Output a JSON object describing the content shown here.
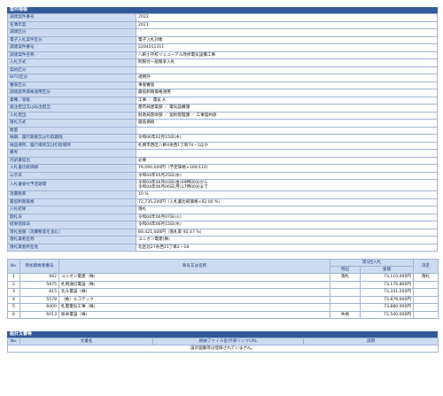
{
  "section_title": "案件情報",
  "info_rows": [
    {
      "key": "調達案件番号",
      "value": "2022"
    },
    {
      "key": "名簿年度",
      "value": "2021"
    },
    {
      "key": "調達区分",
      "value": ""
    },
    {
      "key": "電子入札案件区分",
      "value": "電子入札対象"
    },
    {
      "key": "調達案件番号",
      "value": "2204011311"
    },
    {
      "key": "調達案件名称",
      "value": "八軒小学校リニューアル改修電気設備工事"
    },
    {
      "key": "入札方式",
      "value": "制限付一般競争入札"
    },
    {
      "key": "契約区分",
      "value": ""
    },
    {
      "key": "WTO区分",
      "value": "適用外"
    },
    {
      "key": "審査区分",
      "value": "事後審査"
    },
    {
      "key": "調達基準価格適用区分",
      "value": "最低制限価格適用"
    },
    {
      "key": "業種／等級",
      "value": "工事 ／ 電気 A"
    },
    {
      "key": "発注担当又は払出担当",
      "value": "都市局建築部 ／ 電気設備課"
    },
    {
      "key": "入札担当",
      "value": "財政局管財部 ／ 契約管理課 ／ 工事契約係"
    },
    {
      "key": "落札方式",
      "value": "最低価格"
    },
    {
      "key": "数量",
      "value": ""
    },
    {
      "key": "納期、履行期限又は引取期限",
      "value": "令和06年02月15日(木)"
    },
    {
      "key": "納品場所、履行場所又は引取場所",
      "value": "札幌市西区八軒4条西1丁目74－2ほか"
    },
    {
      "key": "備考",
      "value": ""
    },
    {
      "key": "内訳書提出",
      "value": "必要"
    },
    {
      "key": "入札書比較価格",
      "value": "79,060,000円（予定価格×100/110）"
    },
    {
      "key": "公示日",
      "value": "令和04年05月25日(水)"
    },
    {
      "key": "入札書受付予定期間",
      "value": "令和04年06月03日(金)09時00分から\n令和04年06月06日(月)17時00分まで"
    },
    {
      "key": "消費税率",
      "value": "10 %"
    },
    {
      "key": "最低制限価格",
      "value": "72,735,200円（入札書比較価格×92.00 %）"
    },
    {
      "key": "入札結果",
      "value": "落札"
    },
    {
      "key": "開札日",
      "value": "令和04年06月07日(火)"
    },
    {
      "key": "結果登録日",
      "value": "令和04年06月15日(水)"
    },
    {
      "key": "落札金額（消費税等を含む）",
      "value": "80,421,000円（落札率 92.47 %）"
    },
    {
      "key": "落札業者名称",
      "value": "ユニオン電建(株)"
    },
    {
      "key": "落札業者所在地",
      "value": "北区北27条西15丁目2－18"
    }
  ],
  "bid_table": {
    "headers": {
      "no": "No.",
      "reg": "参加資格者番号",
      "name": "商号又は名称",
      "round": "第1回入札",
      "remark": "特記",
      "amount": "金額",
      "decision": "決定"
    },
    "rows": [
      {
        "no": "1",
        "reg": "942",
        "name": "ユニオン電建（株）",
        "remark": "落札",
        "amount": "73,110,000円",
        "decision": "落札"
      },
      {
        "no": "2",
        "reg": "5975",
        "name": "札幌通信電設（株）",
        "remark": "",
        "amount": "73,176,800円",
        "decision": ""
      },
      {
        "no": "3",
        "reg": "815",
        "name": "北斗電設（株）",
        "remark": "",
        "amount": "73,331,200円",
        "decision": ""
      },
      {
        "no": "4",
        "reg": "5578",
        "name": "（株）エコテック",
        "remark": "",
        "amount": "73,876,000円",
        "decision": ""
      },
      {
        "no": "5",
        "reg": "6000",
        "name": "札電電気工事（株）",
        "remark": "",
        "amount": "73,880,000円",
        "decision": ""
      },
      {
        "no": "6",
        "reg": "6013",
        "name": "坂本電設（株）",
        "remark": "失格",
        "amount": "72,540,000円",
        "decision": ""
      }
    ]
  },
  "doc_section_title": "設計文書等",
  "doc_table": {
    "headers": {
      "no": "No.",
      "name": "文書名",
      "file": "格納ファイル名/外部リンクURL",
      "desc": "説明"
    },
    "empty_message": "設計図書等は登録されていません。"
  }
}
